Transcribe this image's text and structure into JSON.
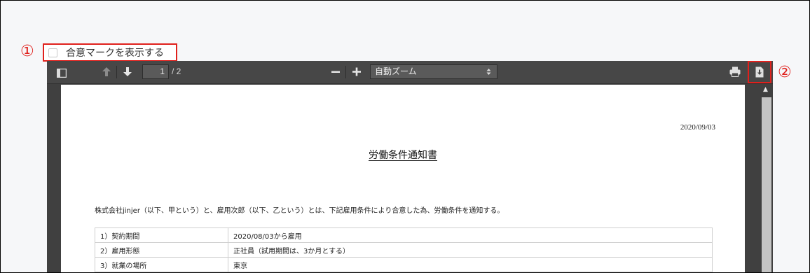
{
  "markers": {
    "one": "①",
    "two": "②"
  },
  "consent": {
    "label": "合意マークを表示する"
  },
  "toolbar": {
    "page_number": "1",
    "page_count": "/ 2",
    "zoom_label": "自動ズーム"
  },
  "document": {
    "date": "2020/09/03",
    "title": "労働条件通知書",
    "intro": "株式会社jinjer（以下、甲という）と、雇用次郎（以下、乙という）とは、下記雇用条件により合意した為、労働条件を通知する。",
    "rows": [
      {
        "label": "1）契約期間",
        "value": "2020/08/03から雇用"
      },
      {
        "label": "2）雇用形態",
        "value": "正社員（試用期間は、3か月とする）"
      },
      {
        "label": "3）就業の場所",
        "value": "東京"
      }
    ]
  }
}
